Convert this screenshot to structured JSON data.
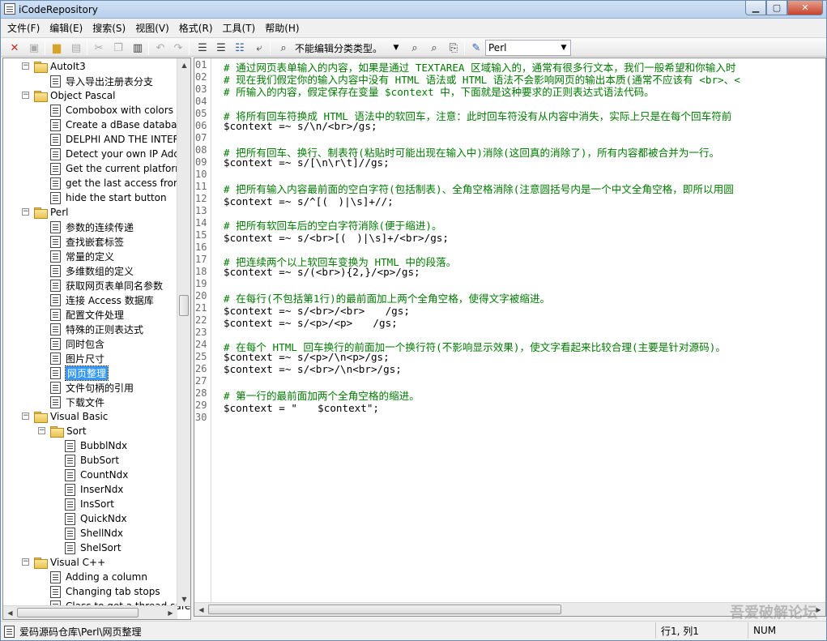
{
  "window": {
    "title": "iCodeRepository"
  },
  "menu": [
    "文件(F)",
    "编辑(E)",
    "搜索(S)",
    "视图(V)",
    "格式(R)",
    "工具(T)",
    "帮助(H)"
  ],
  "toolbar": {
    "category_combo": "不能编辑分类类型。",
    "language_combo": "Perl"
  },
  "tree": [
    {
      "label": "AutoIt3",
      "type": "folder",
      "level": 1,
      "expanded": true
    },
    {
      "label": "导入导出注册表分支",
      "type": "doc",
      "level": 2
    },
    {
      "label": "Object Pascal",
      "type": "folder",
      "level": 1,
      "expanded": true
    },
    {
      "label": "Combobox with colors",
      "type": "doc",
      "level": 2
    },
    {
      "label": "Create a dBase database a",
      "type": "doc",
      "level": 2
    },
    {
      "label": "DELPHI AND THE INTERN",
      "type": "doc",
      "level": 2
    },
    {
      "label": "Detect your own IP Addre",
      "type": "doc",
      "level": 2
    },
    {
      "label": "Get the current platform",
      "type": "doc",
      "level": 2
    },
    {
      "label": "get the last access from a",
      "type": "doc",
      "level": 2
    },
    {
      "label": "hide the start button",
      "type": "doc",
      "level": 2
    },
    {
      "label": "Perl",
      "type": "folder",
      "level": 1,
      "expanded": true
    },
    {
      "label": "参数的连续传递",
      "type": "doc",
      "level": 2
    },
    {
      "label": "查找嵌套标签",
      "type": "doc",
      "level": 2
    },
    {
      "label": "常量的定义",
      "type": "doc",
      "level": 2
    },
    {
      "label": "多维数组的定义",
      "type": "doc",
      "level": 2
    },
    {
      "label": "获取网页表单同名参数",
      "type": "doc",
      "level": 2
    },
    {
      "label": "连接 Access 数据库",
      "type": "doc",
      "level": 2
    },
    {
      "label": "配置文件处理",
      "type": "doc",
      "level": 2
    },
    {
      "label": "特殊的正则表达式",
      "type": "doc",
      "level": 2
    },
    {
      "label": "同时包含",
      "type": "doc",
      "level": 2
    },
    {
      "label": "图片尺寸",
      "type": "doc",
      "level": 2
    },
    {
      "label": "网页整理",
      "type": "doc",
      "level": 2,
      "selected": true
    },
    {
      "label": "文件句柄的引用",
      "type": "doc",
      "level": 2
    },
    {
      "label": "下载文件",
      "type": "doc",
      "level": 2
    },
    {
      "label": "Visual Basic",
      "type": "folder",
      "level": 1,
      "expanded": true
    },
    {
      "label": "Sort",
      "type": "folder",
      "level": 2,
      "expanded": true
    },
    {
      "label": "BubblNdx",
      "type": "doc",
      "level": 3
    },
    {
      "label": "BubSort",
      "type": "doc",
      "level": 3
    },
    {
      "label": "CountNdx",
      "type": "doc",
      "level": 3
    },
    {
      "label": "InserNdx",
      "type": "doc",
      "level": 3
    },
    {
      "label": "InsSort",
      "type": "doc",
      "level": 3
    },
    {
      "label": "QuickNdx",
      "type": "doc",
      "level": 3
    },
    {
      "label": "ShellNdx",
      "type": "doc",
      "level": 3
    },
    {
      "label": "ShelSort",
      "type": "doc",
      "level": 3
    },
    {
      "label": "Visual C++",
      "type": "folder",
      "level": 1,
      "expanded": true
    },
    {
      "label": "Adding a column",
      "type": "doc",
      "level": 2
    },
    {
      "label": "Changing tab stops",
      "type": "doc",
      "level": 2
    },
    {
      "label": "Class to get a thread safe",
      "type": "doc",
      "level": 2
    }
  ],
  "editor": {
    "lines": [
      {
        "n": "01",
        "kind": "cmt",
        "text": "# 通过网页表单输入的内容，如果是通过 TEXTAREA 区域输入的，通常有很多行文本，我们一般希望和你输入时"
      },
      {
        "n": "02",
        "kind": "cmt",
        "text": "# 现在我们假定你的输入内容中没有 HTML 语法或 HTML 语法不会影响网页的输出本质(通常不应该有 <br>、<"
      },
      {
        "n": "03",
        "kind": "cmt",
        "text": "# 所输入的内容，假定保存在变量 $context 中，下面就是这种要求的正则表达式语法代码。"
      },
      {
        "n": "04",
        "kind": "code",
        "text": ""
      },
      {
        "n": "05",
        "kind": "cmt",
        "text": "# 将所有回车符换成 HTML 语法中的软回车，注意：此时回车符没有从内容中消失，实际上只是在每个回车符前"
      },
      {
        "n": "06",
        "kind": "code",
        "text": "$context =~ s/\\n/<br>/gs;"
      },
      {
        "n": "07",
        "kind": "code",
        "text": ""
      },
      {
        "n": "08",
        "kind": "cmt",
        "text": "# 把所有回车、换行、制表符(粘贴时可能出现在输入中)消除(这回真的消除了)，所有内容都被合并为一行。"
      },
      {
        "n": "09",
        "kind": "code",
        "text": "$context =~ s/[\\n\\r\\t]//gs;"
      },
      {
        "n": "10",
        "kind": "code",
        "text": ""
      },
      {
        "n": "11",
        "kind": "cmt",
        "text": "# 把所有输入内容最前面的空白字符(包括制表)、全角空格消除(注意圆括号内是一个中文全角空格，即所以用圆"
      },
      {
        "n": "12",
        "kind": "code",
        "text": "$context =~ s/^[(　)|\\s]+//;"
      },
      {
        "n": "13",
        "kind": "code",
        "text": ""
      },
      {
        "n": "14",
        "kind": "cmt",
        "text": "# 把所有软回车后的空白字符消除(便于缩进)。"
      },
      {
        "n": "15",
        "kind": "code",
        "text": "$context =~ s/<br>[(　)|\\s]+/<br>/gs;"
      },
      {
        "n": "16",
        "kind": "code",
        "text": ""
      },
      {
        "n": "17",
        "kind": "cmt",
        "text": "# 把连续两个以上软回车变换为 HTML 中的段落。"
      },
      {
        "n": "18",
        "kind": "code",
        "text": "$context =~ s/(<br>){2,}/<p>/gs;"
      },
      {
        "n": "19",
        "kind": "code",
        "text": ""
      },
      {
        "n": "20",
        "kind": "cmt",
        "text": "# 在每行(不包括第1行)的最前面加上两个全角空格，使得文字被缩进。"
      },
      {
        "n": "21",
        "kind": "code",
        "text": "$context =~ s/<br>/<br>　　/gs;"
      },
      {
        "n": "22",
        "kind": "code",
        "text": "$context =~ s/<p>/<p>　　/gs;"
      },
      {
        "n": "23",
        "kind": "code",
        "text": ""
      },
      {
        "n": "24",
        "kind": "cmt",
        "text": "# 在每个 HTML 回车换行的前面加一个换行符(不影响显示效果)，使文字看起来比较合理(主要是针对源码)。"
      },
      {
        "n": "25",
        "kind": "code",
        "text": "$context =~ s/<p>/\\n<p>/gs;"
      },
      {
        "n": "26",
        "kind": "code",
        "text": "$context =~ s/<br>/\\n<br>/gs;"
      },
      {
        "n": "27",
        "kind": "code",
        "text": ""
      },
      {
        "n": "28",
        "kind": "cmt",
        "text": "# 第一行的最前面加两个全角空格的缩进。"
      },
      {
        "n": "29",
        "kind": "code",
        "text": "$context = \"　　$context\";"
      },
      {
        "n": "30",
        "kind": "code",
        "text": ""
      }
    ]
  },
  "status": {
    "path": "爱码源码仓库\\Perl\\网页整理",
    "position": "行1, 列1",
    "mode": "NUM"
  },
  "watermark": "吾爱破解论坛"
}
